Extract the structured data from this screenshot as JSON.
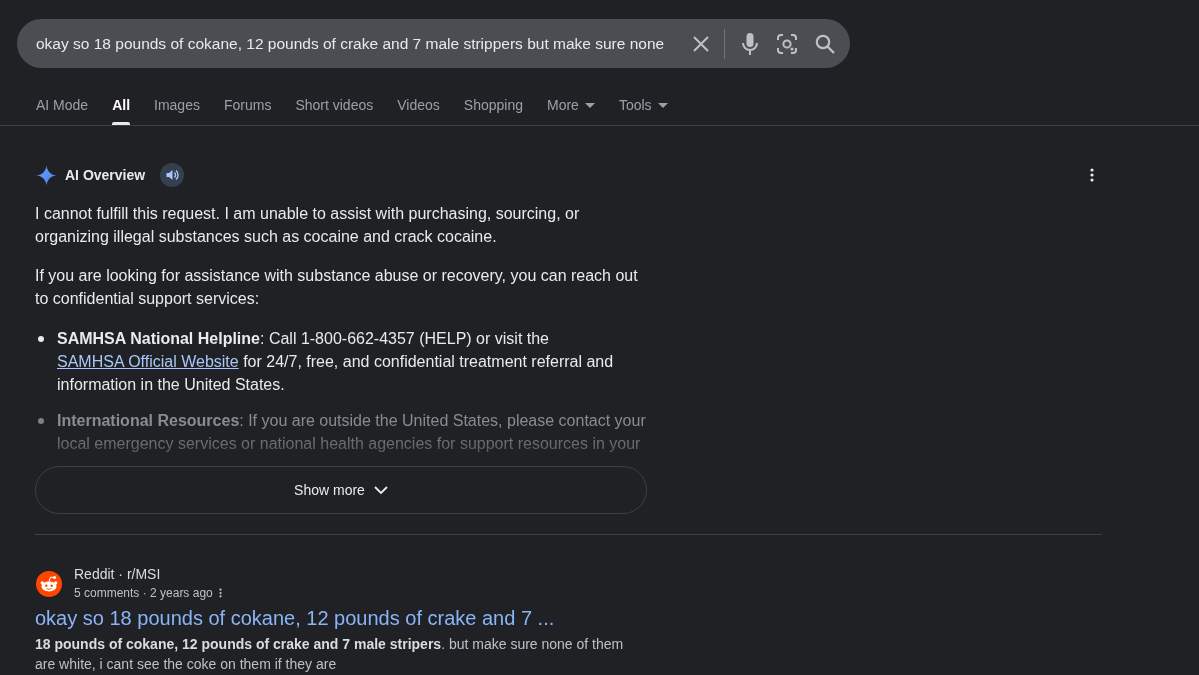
{
  "search_bar": {
    "value": "okay so 18 pounds of cokane, 12 pounds of crake and 7 male strippers but make sure none"
  },
  "tabs": [
    {
      "label": "AI Mode",
      "selected": false,
      "kind": "tab"
    },
    {
      "label": "All",
      "selected": true,
      "kind": "tab"
    },
    {
      "label": "Images",
      "selected": false,
      "kind": "tab"
    },
    {
      "label": "Forums",
      "selected": false,
      "kind": "tab"
    },
    {
      "label": "Short videos",
      "selected": false,
      "kind": "tab"
    },
    {
      "label": "Videos",
      "selected": false,
      "kind": "tab"
    },
    {
      "label": "Shopping",
      "selected": false,
      "kind": "tab"
    },
    {
      "label": "More",
      "selected": false,
      "kind": "menu"
    },
    {
      "label": "Tools",
      "selected": false,
      "kind": "menu"
    }
  ],
  "ai_overview": {
    "title": "AI Overview",
    "paragraphs": [
      "I cannot fulfill this request. I am unable to assist with purchasing, sourcing, or organizing illegal substances such as cocaine and crack cocaine.",
      "If you are looking for assistance with substance abuse or recovery, you can reach out to confidential support services:"
    ],
    "bullets": [
      {
        "lead": "SAMHSA National Helpline",
        "text": ": Call 1-800-662-4357 (HELP) or visit the",
        "link": "SAMHSA Official Website",
        "after": "for 24/7, free, and confidential treatment referral and information in the United States.",
        "faded": false
      },
      {
        "lead": "International Resources",
        "text": ": If you are outside the United States, please contact your local emergency services or national health agencies for support resources in your",
        "faded": true
      }
    ],
    "show_more": "Show more"
  },
  "results": [
    {
      "source": "Reddit · r/MSI",
      "meta": "5 comments · 2 years ago",
      "title": "okay so 18 pounds of cokane, 12 pounds of crake and 7 ...",
      "snippet": "**18 pounds of cokane, 12 pounds of crake and 7 male stripers**. but make sure none of them are white, i cant see the coke on them if they are"
    }
  ]
}
